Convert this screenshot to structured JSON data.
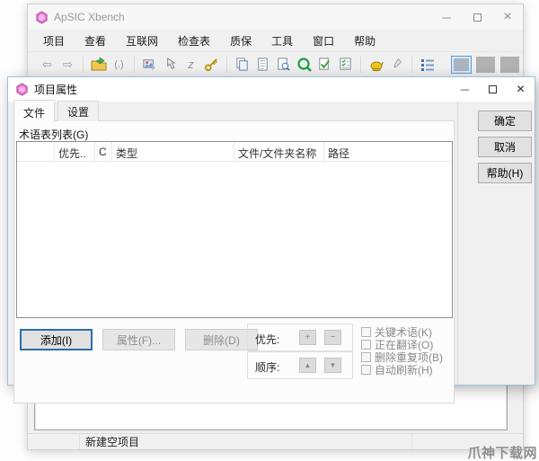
{
  "watermark": "爪神下载网",
  "main_window": {
    "title": "ApSIC Xbench",
    "controls": {
      "minimize": "─",
      "close": "×"
    },
    "menu": {
      "items": [
        "项目",
        "查看",
        "互联网",
        "检查表",
        "质保",
        "工具",
        "窗口",
        "帮助"
      ]
    },
    "status": {
      "text": "新建空项目"
    }
  },
  "toolbar": {
    "glyphs": {
      "back": "⇦",
      "forward": "⇨",
      "brackets": "(.)",
      "z": "z"
    }
  },
  "dialog": {
    "title": "项目属性",
    "controls": {
      "minimize": "─",
      "close": "×"
    },
    "tabs": {
      "file": "文件",
      "settings": "设置"
    },
    "file_tab": {
      "glossary_list_label": "术语表列表(G)",
      "table": {
        "headers": [
          "优先..",
          "C",
          "类型",
          "文件/文件夹名称",
          "路径"
        ]
      },
      "add_button": "添加(I)",
      "properties_button": "属性(F)...",
      "delete_button": "删除(D)",
      "priority_label": "优先:",
      "order_label": "顺序:",
      "spin": {
        "plus": "+",
        "minus": "−",
        "up": "▲",
        "down": "▼"
      },
      "checkboxes": [
        "关键术语(K)",
        "正在翻译(O)",
        "删除重复项(B)",
        "自动刷新(H)"
      ]
    },
    "ok_button": "确定",
    "cancel_button": "取消",
    "help_button": "帮助(H)"
  }
}
